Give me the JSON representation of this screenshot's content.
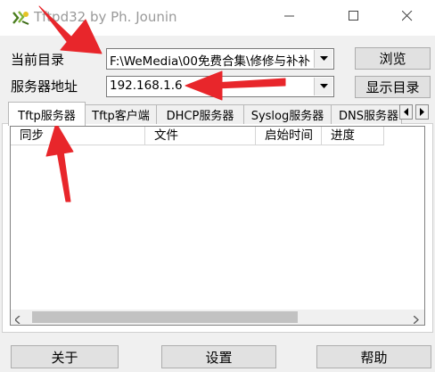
{
  "window": {
    "title": "Tftpd32 by Ph. Jounin",
    "controls": [
      "minimize-icon",
      "maximize-icon",
      "close-icon"
    ]
  },
  "form": {
    "current_dir_label": "当前目录",
    "current_dir_value": "F:\\WeMedia\\00免费合集\\修修与补补",
    "server_addr_label": "服务器地址",
    "server_addr_value": "192.168.1.6",
    "browse_button": "浏览",
    "show_dir_button": "显示目录"
  },
  "tabs": [
    {
      "label": "Tftp服务器",
      "active": true
    },
    {
      "label": "Tftp客户端",
      "active": false
    },
    {
      "label": "DHCP服务器",
      "active": false
    },
    {
      "label": "Syslog服务器",
      "active": false
    },
    {
      "label": "DNS服务器",
      "active": false
    }
  ],
  "table": {
    "columns": [
      "同步",
      "文件",
      "启始时间",
      "进度"
    ],
    "rows": []
  },
  "footer": {
    "about_button": "关于",
    "settings_button": "设置",
    "help_button": "帮助"
  },
  "colors": {
    "annotation_arrow": "#e8262b",
    "window_bg": "#f0f0f0",
    "button_bg": "#e1e1e1"
  }
}
